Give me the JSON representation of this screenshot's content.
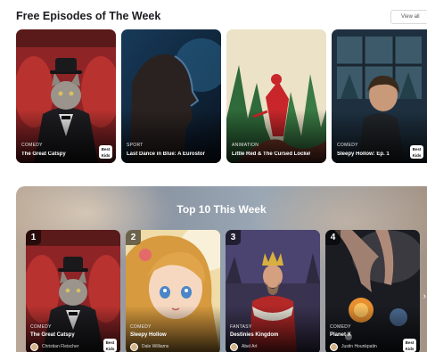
{
  "free_section": {
    "title": "Free Episodes of The Week",
    "view_all_label": "View all",
    "cards": [
      {
        "genre": "COMEDY",
        "title": "The Great Catspy",
        "badge": "Best Kids"
      },
      {
        "genre": "SPORT",
        "title": "Last Dance in Blue: A Eurostory"
      },
      {
        "genre": "ANIMATION",
        "title": "Little Red & The Cursed Locket"
      },
      {
        "genre": "COMEDY",
        "title": "Sleepy Hollow: Ep. 1",
        "badge": "Best Kids"
      }
    ]
  },
  "top10": {
    "title": "Top 10 This Week",
    "cards": [
      {
        "rank": "1",
        "genre": "COMEDY",
        "title": "The Great Catspy",
        "author": "Christian Fleischer",
        "badge": "Best Kids"
      },
      {
        "rank": "2",
        "genre": "COMEDY",
        "title": "Sleepy Hollow",
        "author": "Dale Williams"
      },
      {
        "rank": "3",
        "genre": "FANTASY",
        "title": "Destinies Kingdom",
        "author": "Abel Art"
      },
      {
        "rank": "4",
        "genre": "COMEDY",
        "title": "Planet X",
        "author": "Justin Hounkpatin",
        "badge": "Best Kids"
      }
    ],
    "next_icon": "chevron-right-icon"
  },
  "colors": {
    "page_bg": "#ffffff",
    "title_text": "#1d1d22"
  }
}
